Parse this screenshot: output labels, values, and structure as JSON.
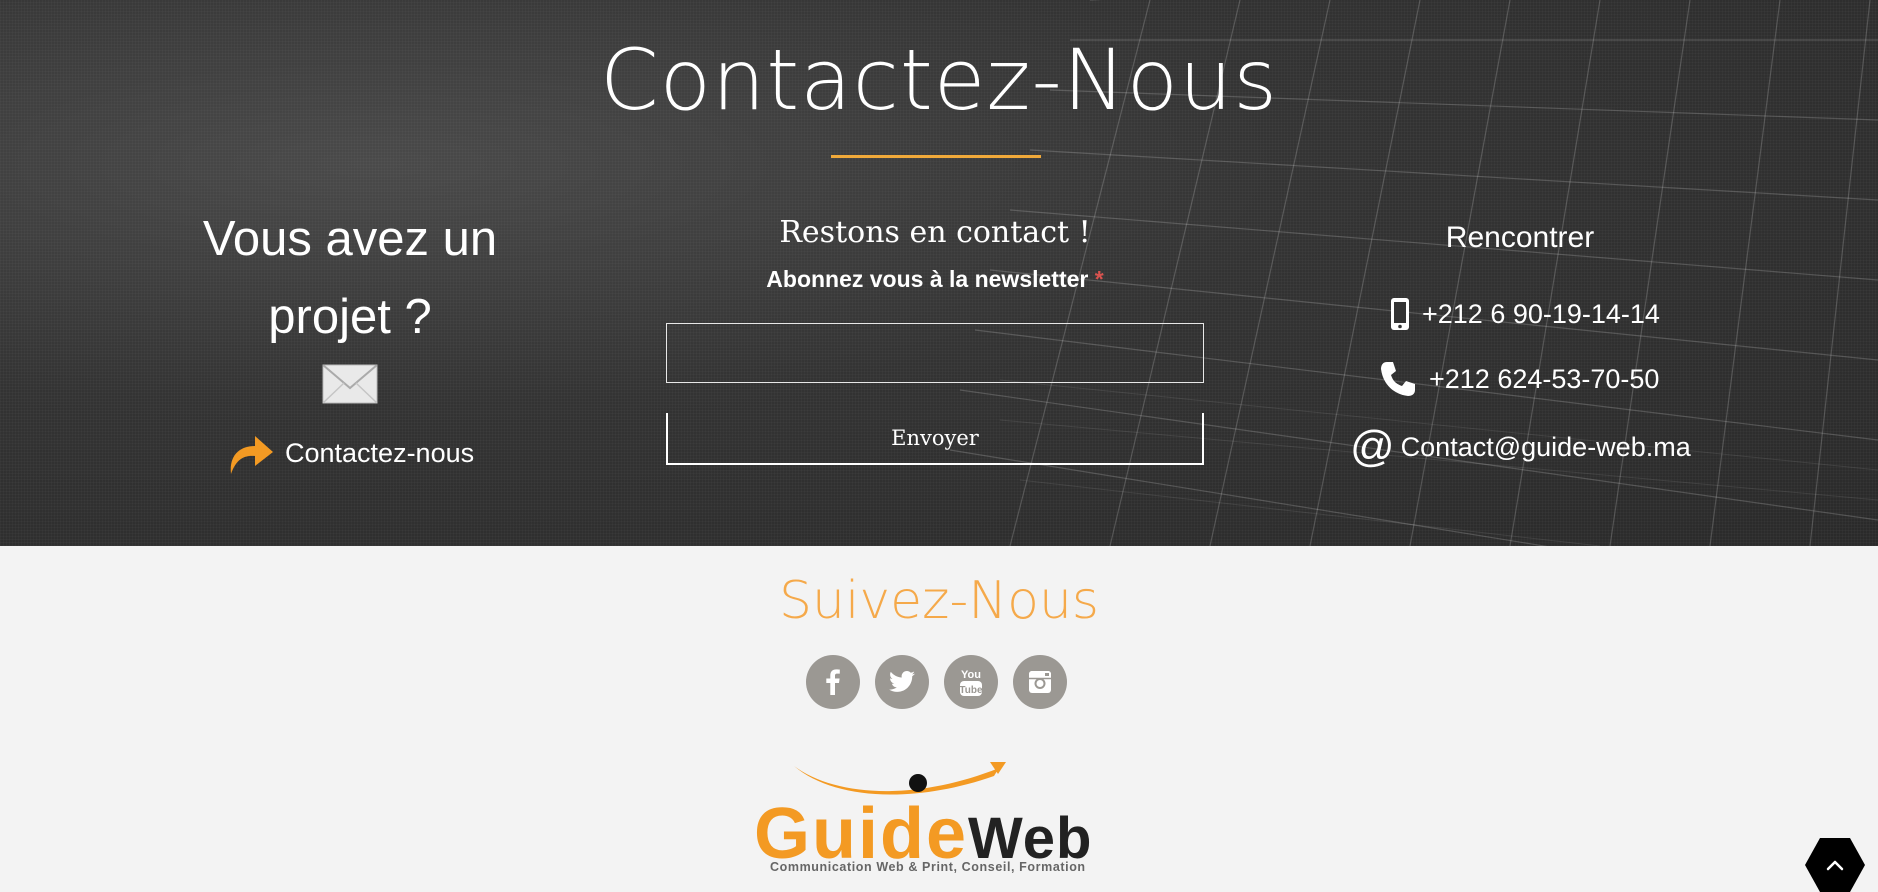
{
  "hero": {
    "title": "Contactez-Nous"
  },
  "project": {
    "heading": "Vous avez un projet ?",
    "contact_link": "Contactez-nous"
  },
  "newsletter": {
    "heading": "Restons en contact !",
    "label": "Abonnez vous à la newsletter",
    "required_mark": "*",
    "email_value": "",
    "submit_label": "Envoyer"
  },
  "meet": {
    "heading": "Rencontrer",
    "mobile": "+212 6 90-19-14-14",
    "phone": "+212 624-53-70-50",
    "email": "Contact@guide-web.ma"
  },
  "follow": {
    "title": "Suivez-Nous",
    "networks": [
      {
        "name": "facebook",
        "icon": "facebook-icon"
      },
      {
        "name": "twitter",
        "icon": "twitter-icon"
      },
      {
        "name": "youtube",
        "icon": "youtube-icon"
      },
      {
        "name": "instagram",
        "icon": "instagram-icon"
      }
    ]
  },
  "logo": {
    "guide": "Guide",
    "web": "Web",
    "tagline": "Communication Web & Print, Conseil, Formation"
  },
  "colors": {
    "accent_orange": "#f0a93a",
    "footer_bg": "#f3f3f3",
    "social_grey": "#9b9893"
  }
}
